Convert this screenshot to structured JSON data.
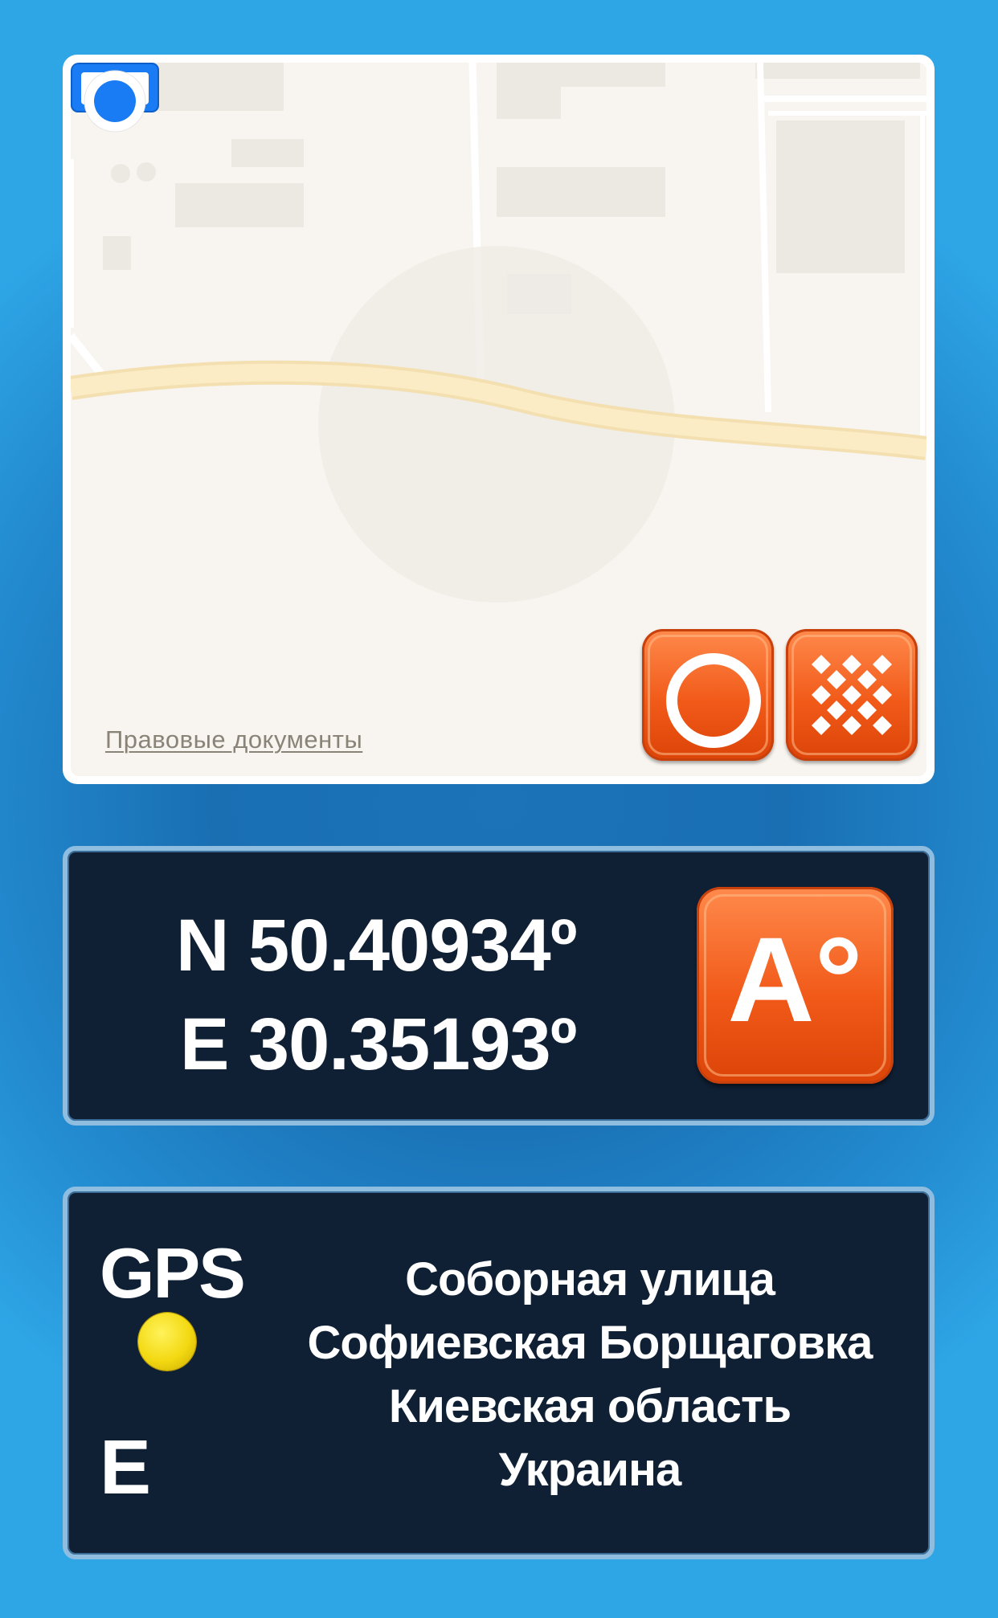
{
  "map": {
    "legal_link": "Правовые документы",
    "record_button_icon": "record-ring-icon",
    "grid_button_icon": "checker-grid-icon",
    "location_marker_icon": "user-location-icon",
    "colors": {
      "map_background": "#f8f5f0",
      "road": "#fbe7b8",
      "location_blue": "#1a7cf5",
      "button_orange": "#f15a19"
    }
  },
  "coordinates": {
    "latitude": "N 50.40934º",
    "longitude": "E 30.35193º",
    "format_button_label": "A°"
  },
  "status": {
    "gps_label": "GPS",
    "gps_indicator_color": "#f3d912",
    "direction": "E"
  },
  "address": {
    "street": "Соборная улица",
    "locality": "Софиевская Борщаговка",
    "region": "Киевская область",
    "country": "Украина"
  }
}
